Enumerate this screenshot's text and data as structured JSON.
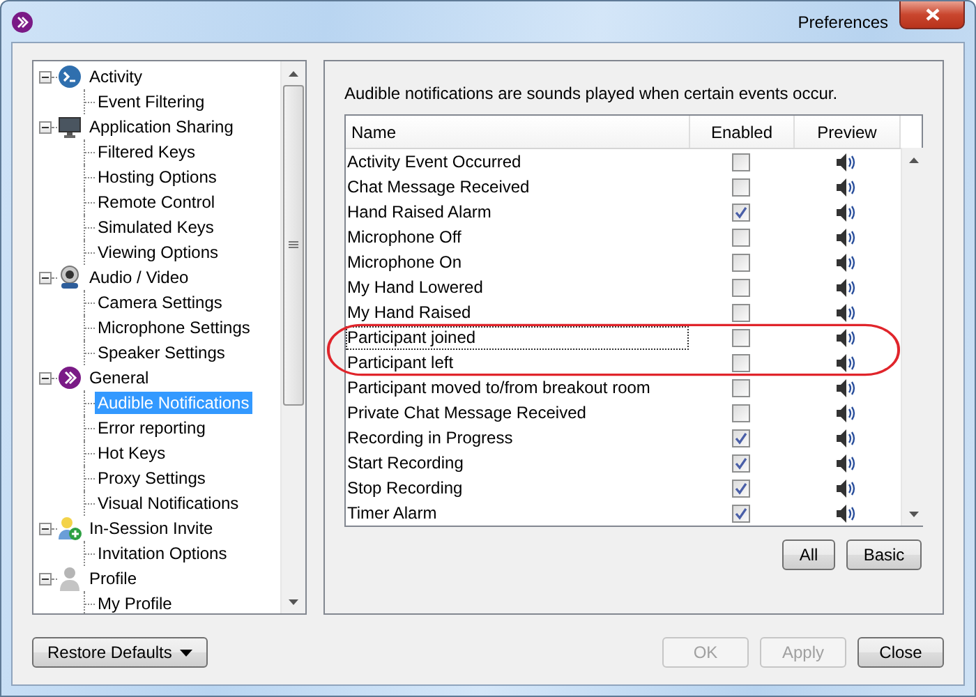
{
  "window": {
    "title": "Preferences"
  },
  "tree": [
    {
      "label": "Activity",
      "expanded": true,
      "selected": false,
      "children": [
        {
          "label": "Event Filtering",
          "selected": false
        }
      ]
    },
    {
      "label": "Application Sharing",
      "expanded": true,
      "selected": false,
      "children": [
        {
          "label": "Filtered Keys",
          "selected": false
        },
        {
          "label": "Hosting Options",
          "selected": false
        },
        {
          "label": "Remote Control",
          "selected": false
        },
        {
          "label": "Simulated Keys",
          "selected": false
        },
        {
          "label": "Viewing Options",
          "selected": false
        }
      ]
    },
    {
      "label": "Audio / Video",
      "expanded": true,
      "selected": false,
      "children": [
        {
          "label": "Camera Settings",
          "selected": false
        },
        {
          "label": "Microphone Settings",
          "selected": false
        },
        {
          "label": "Speaker Settings",
          "selected": false
        }
      ]
    },
    {
      "label": "General",
      "expanded": true,
      "selected": false,
      "children": [
        {
          "label": "Audible Notifications",
          "selected": true
        },
        {
          "label": "Error reporting",
          "selected": false
        },
        {
          "label": "Hot Keys",
          "selected": false
        },
        {
          "label": "Proxy Settings",
          "selected": false
        },
        {
          "label": "Visual Notifications",
          "selected": false
        }
      ]
    },
    {
      "label": "In-Session Invite",
      "expanded": true,
      "selected": false,
      "children": [
        {
          "label": "Invitation Options",
          "selected": false
        }
      ]
    },
    {
      "label": "Profile",
      "expanded": true,
      "selected": false,
      "children": [
        {
          "label": "My Profile",
          "selected": false
        }
      ]
    }
  ],
  "description": "Audible notifications are sounds played when certain events occur.",
  "table": {
    "columns": [
      "Name",
      "Enabled",
      "Preview"
    ],
    "rows": [
      {
        "name": "Activity Event Occurred",
        "enabled": false,
        "focused": false,
        "circled": false
      },
      {
        "name": "Chat Message Received",
        "enabled": false,
        "focused": false,
        "circled": false
      },
      {
        "name": "Hand Raised Alarm",
        "enabled": true,
        "focused": false,
        "circled": false
      },
      {
        "name": "Microphone Off",
        "enabled": false,
        "focused": false,
        "circled": false
      },
      {
        "name": "Microphone On",
        "enabled": false,
        "focused": false,
        "circled": false
      },
      {
        "name": "My Hand Lowered",
        "enabled": false,
        "focused": false,
        "circled": false
      },
      {
        "name": "My Hand Raised",
        "enabled": false,
        "focused": false,
        "circled": false
      },
      {
        "name": "Participant joined",
        "enabled": false,
        "focused": true,
        "circled": true
      },
      {
        "name": "Participant left",
        "enabled": false,
        "focused": false,
        "circled": true
      },
      {
        "name": "Participant moved to/from breakout room",
        "enabled": false,
        "focused": false,
        "circled": false
      },
      {
        "name": "Private Chat Message Received",
        "enabled": false,
        "focused": false,
        "circled": false
      },
      {
        "name": "Recording in Progress",
        "enabled": true,
        "focused": false,
        "circled": false
      },
      {
        "name": "Start Recording",
        "enabled": true,
        "focused": false,
        "circled": false
      },
      {
        "name": "Stop Recording",
        "enabled": true,
        "focused": false,
        "circled": false
      },
      {
        "name": "Timer Alarm",
        "enabled": true,
        "focused": false,
        "circled": false
      }
    ]
  },
  "table_buttons": [
    "All",
    "Basic"
  ],
  "footer": {
    "restore": "Restore Defaults",
    "buttons": [
      {
        "label": "OK",
        "disabled": true
      },
      {
        "label": "Apply",
        "disabled": true
      },
      {
        "label": "Close",
        "disabled": false
      }
    ]
  }
}
